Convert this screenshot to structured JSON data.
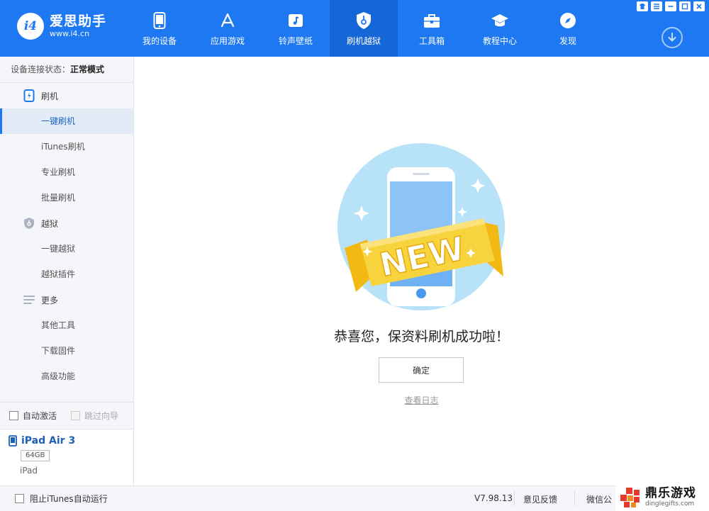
{
  "app": {
    "logo_mark": "i4",
    "logo_title": "爱思助手",
    "logo_url": "www.i4.cn"
  },
  "nav": {
    "items": [
      {
        "label": "我的设备",
        "icon": "phone-icon"
      },
      {
        "label": "应用游戏",
        "icon": "app-store-icon"
      },
      {
        "label": "铃声壁纸",
        "icon": "music-icon"
      },
      {
        "label": "刷机越狱",
        "icon": "shield-icon",
        "active": true
      },
      {
        "label": "工具箱",
        "icon": "toolbox-icon"
      },
      {
        "label": "教程中心",
        "icon": "graduation-cap-icon"
      },
      {
        "label": "发现",
        "icon": "compass-icon"
      }
    ]
  },
  "sidebar": {
    "status_label": "设备连接状态：",
    "status_value": "正常模式",
    "groups": [
      {
        "label": "刷机",
        "icon": "flash-phone-icon",
        "items": [
          "一键刷机",
          "iTunes刷机",
          "专业刷机",
          "批量刷机"
        ]
      },
      {
        "label": "越狱",
        "icon": "jailbreak-shield-icon",
        "items": [
          "一键越狱",
          "越狱插件"
        ]
      },
      {
        "label": "更多",
        "icon": "menu-lines-icon",
        "items": [
          "其他工具",
          "下载固件",
          "高级功能"
        ]
      }
    ],
    "active_item": "一键刷机",
    "auto_activate": "自动激活",
    "skip_guide": "跳过向导"
  },
  "device": {
    "name": "iPad Air 3",
    "storage": "64GB",
    "type": "iPad"
  },
  "main": {
    "hero_badge": "NEW",
    "success_message": "恭喜您，保资料刷机成功啦！",
    "confirm_label": "确定",
    "view_log_label": "查看日志"
  },
  "bottom": {
    "block_itunes": "阻止iTunes自动运行",
    "version": "V7.98.13",
    "feedback": "意见反馈",
    "wechat": "微信公"
  },
  "watermark": {
    "title": "鼎乐游戏",
    "url": "dinglegifts.com"
  },
  "colors": {
    "brand_blue": "#1d78f2",
    "sidebar_bg": "#f4f6fa",
    "ribbon_yellow": "#f7d33d"
  }
}
